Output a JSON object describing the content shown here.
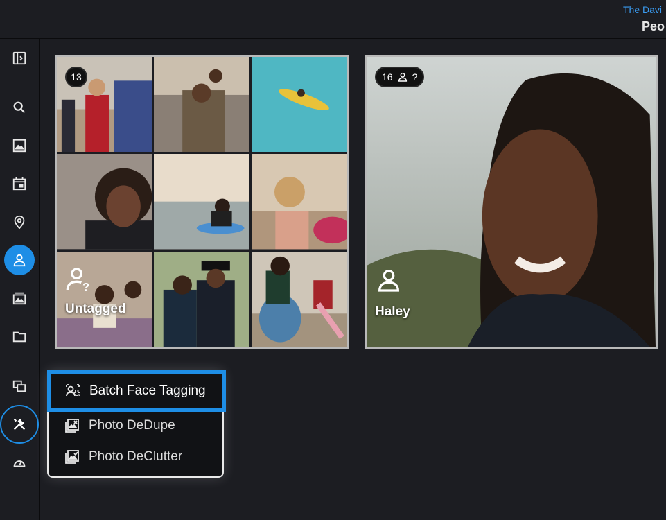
{
  "header": {
    "library_name": "The Davi",
    "page_title": "Peo"
  },
  "sidebar": {
    "items": [
      {
        "icon": "sidebar-toggle-icon",
        "active": false
      },
      {
        "icon": "search-icon",
        "active": false
      },
      {
        "icon": "image-icon",
        "active": false
      },
      {
        "icon": "calendar-icon",
        "active": false
      },
      {
        "icon": "location-pin-icon",
        "active": false
      },
      {
        "icon": "person-icon",
        "active": true
      },
      {
        "icon": "album-icon",
        "active": false
      },
      {
        "icon": "folder-icon",
        "active": false
      },
      {
        "icon": "slideshow-icon",
        "active": false
      },
      {
        "icon": "tools-icon",
        "active": false,
        "ringed": true
      },
      {
        "icon": "gauge-icon",
        "active": false
      }
    ],
    "accent_color": "#1e8ee6"
  },
  "people": [
    {
      "label": "Untagged",
      "count": "13",
      "icon": "person-question-icon"
    },
    {
      "label": "Haley",
      "count": "16",
      "count_suffix": "?",
      "icon": "person-icon"
    }
  ],
  "tools_menu": {
    "items": [
      {
        "label": "Batch Face Tagging",
        "icon": "face-tag-icon",
        "highlighted": true
      },
      {
        "label": "Photo DeDupe",
        "icon": "photo-dedupe-icon",
        "highlighted": false
      },
      {
        "label": "Photo DeClutter",
        "icon": "photo-declutter-icon",
        "highlighted": false
      }
    ]
  }
}
